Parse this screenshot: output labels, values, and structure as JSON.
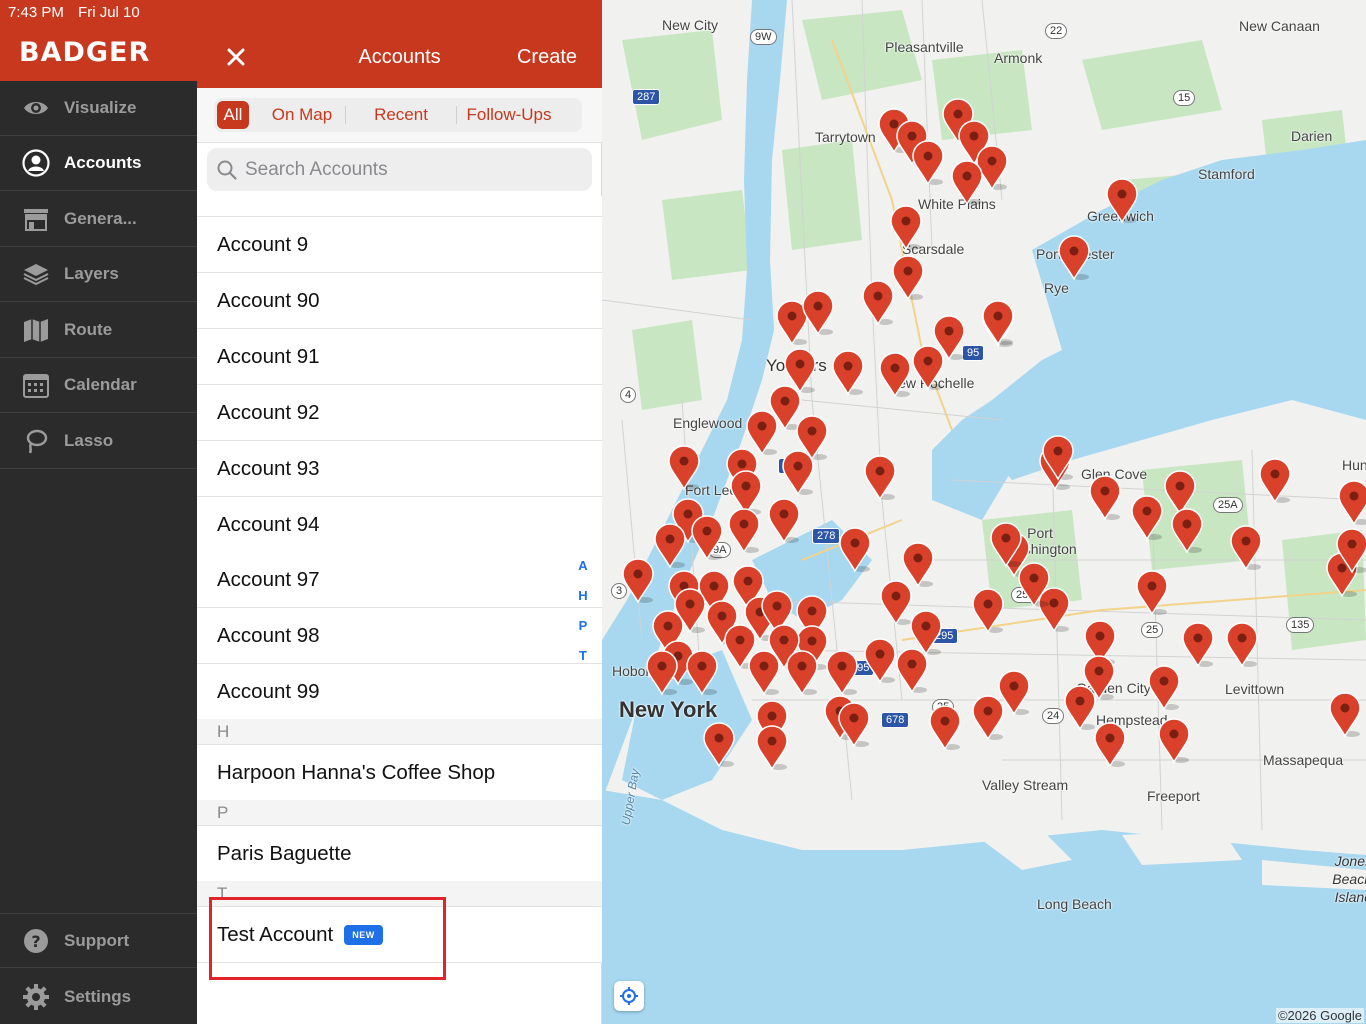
{
  "status_bar": {
    "time": "7:43 PM",
    "date": "Fri Jul 10"
  },
  "brand": "BADGER",
  "nav": {
    "items": [
      {
        "label": "Visualize",
        "icon": "eye-icon",
        "active": false
      },
      {
        "label": "Accounts",
        "icon": "user-circle-icon",
        "active": true
      },
      {
        "label": "Genera...",
        "icon": "storefront-icon",
        "active": false
      },
      {
        "label": "Layers",
        "icon": "layers-icon",
        "active": false
      },
      {
        "label": "Route",
        "icon": "map-icon",
        "active": false
      },
      {
        "label": "Calendar",
        "icon": "calendar-icon",
        "active": false
      },
      {
        "label": "Lasso",
        "icon": "lasso-icon",
        "active": false
      }
    ],
    "support": "Support",
    "settings": "Settings"
  },
  "panel": {
    "title": "Accounts",
    "create": "Create",
    "segments": [
      "All",
      "On Map",
      "Recent",
      "Follow-Ups"
    ],
    "active_segment": "All",
    "search_placeholder": "Search Accounts",
    "index_letters": [
      "A",
      "H",
      "P",
      "T"
    ],
    "accounts_a": [
      "Account 9",
      "Account 90",
      "Account 91",
      "Account 92",
      "Account 93",
      "Account 94",
      "Account 97",
      "Account 98",
      "Account 99"
    ],
    "section_h": "H",
    "account_h": "Harpoon Hanna's Coffee Shop",
    "section_p": "P",
    "account_p": "Paris Baguette",
    "section_t": "T",
    "account_t": "Test Account",
    "new_badge": "NEW"
  },
  "map": {
    "labels": {
      "new_city": "New City",
      "pleasantville": "Pleasantville",
      "armonk": "Armonk",
      "new_canaan": "New Canaan",
      "tarrytown": "Tarrytown",
      "darien": "Darien",
      "stamford": "Stamford",
      "white_plains": "White Plains",
      "greenwich": "Greenwich",
      "scarsdale": "Scarsdale",
      "port_chester": "Port Chester",
      "rye": "Rye",
      "yonkers": "Yonkers",
      "new_rochelle": "New Rochelle",
      "englewood": "Englewood",
      "fort_lee": "Fort Lee",
      "glen_cove": "Glen Cove",
      "hunt": "Hunt",
      "port_washington": "Port Washington",
      "hoboken": "Hoboken",
      "new_york": "New York",
      "garden_city": "Garden City",
      "levittown": "Levittown",
      "hempstead": "Hempstead",
      "massapequa": "Massapequa",
      "valley_stream": "Valley Stream",
      "freeport": "Freeport",
      "upper_bay": "Upper Bay",
      "jones_beach_island": "Jones Beach Island",
      "long_beach": "Long Beach"
    },
    "shields": [
      "9W",
      "22",
      "287",
      "15",
      "95",
      "4",
      "87",
      "278",
      "9A",
      "3",
      "25A",
      "295",
      "25",
      "135",
      "495",
      "678",
      "24"
    ],
    "copyright": "©2026 Google",
    "water_color": "#a7d8f0",
    "pin_color": "#d9412b"
  }
}
